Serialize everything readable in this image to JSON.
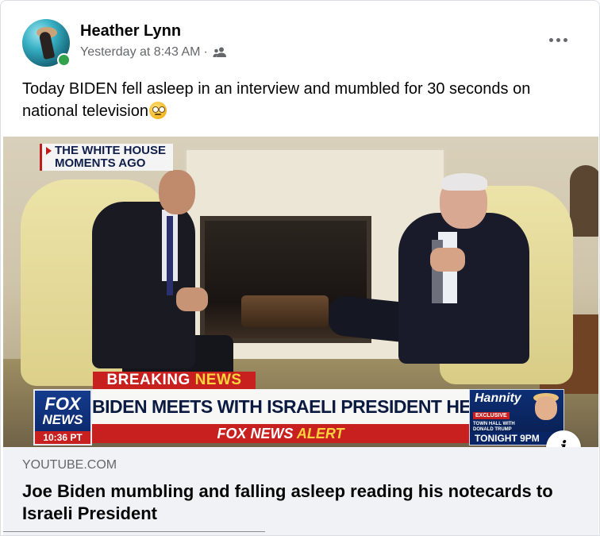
{
  "post": {
    "author": "Heather Lynn",
    "timestamp": "Yesterday at 8:43 AM",
    "separator": "·",
    "audience_icon": "friends-icon",
    "more_icon": "more-horizontal-icon",
    "text": "Today BIDEN fell asleep in an interview and mumbled for 30 seconds on national television",
    "emoji": "face-with-rolling-eyes"
  },
  "video": {
    "tag_line1": "THE WHITE HOUSE",
    "tag_line2": "MOMENTS AGO",
    "breaking_word1": "BREAKING",
    "breaking_word2": "NEWS",
    "logo_line1": "FOX",
    "logo_line2": "NEWS",
    "logo_time": "10:36 PT",
    "headline": "BIDEN MEETS WITH ISRAELI PRESIDENT HERZOG AT WH",
    "alert_word1": "FOX NEWS",
    "alert_word2": "ALERT",
    "promo_show": "Hannity",
    "promo_exclusive": "EXCLUSIVE",
    "promo_sub": "TOWN HALL WITH DONALD TRUMP",
    "promo_time": "TONIGHT 9PM",
    "info_icon": "info-icon"
  },
  "link": {
    "domain": "YOUTUBE.COM",
    "title": "Joe Biden mumbling and falling asleep reading his notecards to Israeli President"
  },
  "colors": {
    "online": "#31a24c",
    "fox_red": "#c8201f",
    "fox_blue": "#0a2566",
    "secondary_text": "#65676b",
    "link_bg": "#f0f2f5"
  }
}
